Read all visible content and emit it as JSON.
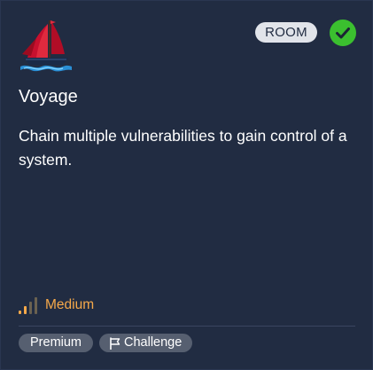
{
  "card": {
    "logo_icon": "sailboat-icon",
    "badge": "ROOM",
    "status_icon": "check-circle-icon",
    "status_color": "#3bbf2f",
    "title": "Voyage",
    "description": "Chain multiple vulnerabilities to gain control of a system.",
    "difficulty": {
      "icon": "signal-bars-icon",
      "label": "Medium",
      "color": "#f6a94a"
    },
    "tags": [
      {
        "label": "Premium"
      },
      {
        "icon": "flag-icon",
        "label": "Challenge"
      }
    ]
  }
}
